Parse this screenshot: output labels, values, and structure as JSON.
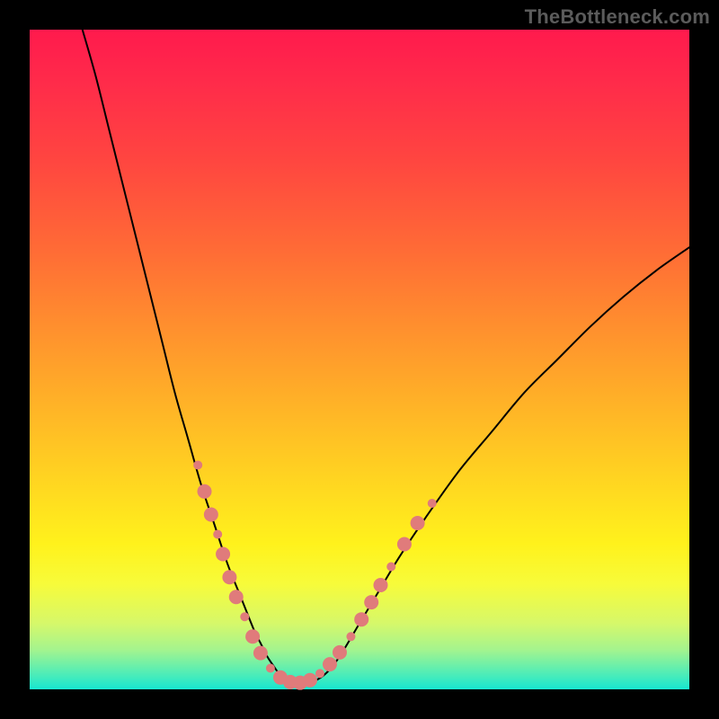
{
  "watermark": "TheBottleneck.com",
  "chart_data": {
    "type": "line",
    "title": "",
    "xlabel": "",
    "ylabel": "",
    "xlim": [
      0,
      100
    ],
    "ylim": [
      0,
      100
    ],
    "grid": false,
    "series": [
      {
        "name": "curve",
        "color": "#000000",
        "x": [
          8,
          10,
          12,
          14,
          16,
          18,
          20,
          22,
          24,
          26,
          28,
          30,
          32,
          34,
          35,
          36,
          37,
          38,
          39.5,
          41,
          43,
          45,
          47,
          50,
          53,
          56,
          60,
          65,
          70,
          75,
          80,
          85,
          90,
          95,
          100
        ],
        "y": [
          100,
          93,
          85,
          77,
          69,
          61,
          53,
          45,
          38,
          31,
          25,
          19,
          14,
          9,
          7,
          5,
          3.5,
          2.2,
          1.3,
          1.0,
          1.2,
          2.5,
          5,
          10,
          15,
          20,
          26,
          33,
          39,
          45,
          50,
          55,
          59.5,
          63.5,
          67
        ]
      }
    ],
    "markers": {
      "color": "#e07b7b",
      "radius_small": 5,
      "radius_large": 8,
      "points": [
        {
          "x": 25.5,
          "y": 34,
          "r": "small"
        },
        {
          "x": 26.5,
          "y": 30,
          "r": "large"
        },
        {
          "x": 27.5,
          "y": 26.5,
          "r": "large"
        },
        {
          "x": 28.5,
          "y": 23.5,
          "r": "small"
        },
        {
          "x": 29.3,
          "y": 20.5,
          "r": "large"
        },
        {
          "x": 30.3,
          "y": 17,
          "r": "large"
        },
        {
          "x": 31.3,
          "y": 14,
          "r": "large"
        },
        {
          "x": 32.6,
          "y": 11,
          "r": "small"
        },
        {
          "x": 33.8,
          "y": 8,
          "r": "large"
        },
        {
          "x": 35.0,
          "y": 5.5,
          "r": "large"
        },
        {
          "x": 36.5,
          "y": 3.2,
          "r": "small"
        },
        {
          "x": 38.0,
          "y": 1.8,
          "r": "large"
        },
        {
          "x": 39.5,
          "y": 1.1,
          "r": "large"
        },
        {
          "x": 41.0,
          "y": 1.0,
          "r": "large"
        },
        {
          "x": 42.5,
          "y": 1.4,
          "r": "large"
        },
        {
          "x": 44.0,
          "y": 2.4,
          "r": "small"
        },
        {
          "x": 45.5,
          "y": 3.8,
          "r": "large"
        },
        {
          "x": 47.0,
          "y": 5.6,
          "r": "large"
        },
        {
          "x": 48.7,
          "y": 8.0,
          "r": "small"
        },
        {
          "x": 50.3,
          "y": 10.6,
          "r": "large"
        },
        {
          "x": 51.8,
          "y": 13.2,
          "r": "large"
        },
        {
          "x": 53.2,
          "y": 15.8,
          "r": "large"
        },
        {
          "x": 54.8,
          "y": 18.6,
          "r": "small"
        },
        {
          "x": 56.8,
          "y": 22.0,
          "r": "large"
        },
        {
          "x": 58.8,
          "y": 25.2,
          "r": "large"
        },
        {
          "x": 61.0,
          "y": 28.2,
          "r": "small"
        }
      ]
    }
  }
}
